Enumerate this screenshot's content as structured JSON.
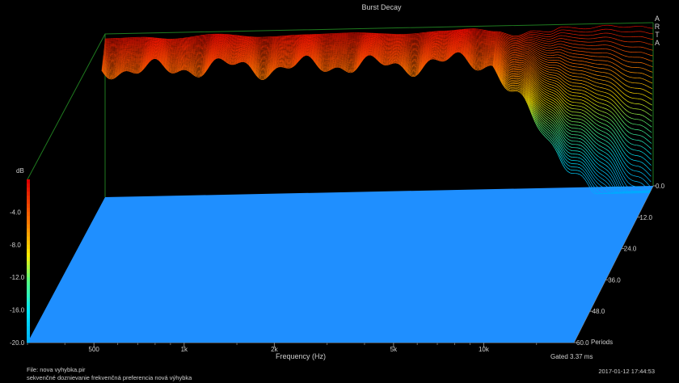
{
  "chart_data": {
    "type": "waterfall",
    "title": "Burst Decay",
    "brand": "ARTA",
    "xlabel": "Frequency (Hz)",
    "ylabel": "dB",
    "x_scale": "log",
    "xlim": [
      300,
      20000
    ],
    "x_ticks": [
      "500",
      "1k",
      "2k",
      "5k",
      "10k"
    ],
    "x_tick_values": [
      500,
      1000,
      2000,
      5000,
      10000
    ],
    "zlim": [
      -20,
      0
    ],
    "z_ticks": [
      "-4.0",
      "-8.0",
      "-12.0",
      "-16.0",
      "-20.0"
    ],
    "z_tick_values": [
      -4,
      -8,
      -12,
      -16,
      -20
    ],
    "depth_label": "Periods",
    "depth_ticks": [
      "0.0",
      "12.0",
      "24.0",
      "36.0",
      "48.0",
      "60.0"
    ],
    "depth_tick_values": [
      0,
      12,
      24,
      36,
      48,
      60
    ],
    "gated": "Gated 3.37 ms",
    "file": "File: nova vyhybka.pir",
    "description": "sekvenčné doznievanie frekvenčná preferencia nová výhybka",
    "datetime": "2017-01-12  17:44:53",
    "floor_color": "#1f8fff",
    "initial_response_db": {
      "freq_hz": [
        300,
        400,
        500,
        700,
        1000,
        1400,
        2000,
        3000,
        4000,
        5000,
        6000,
        7000,
        8000,
        9000,
        10000,
        12000,
        14000,
        16000,
        18000,
        20000
      ],
      "level_db": [
        -0.6,
        -0.5,
        -0.8,
        -0.3,
        -0.8,
        -0.6,
        -0.5,
        -0.8,
        -0.5,
        -0.3,
        -0.7,
        -1.3,
        -0.7,
        -0.9,
        -0.3,
        -0.6,
        -0.2,
        -0.5,
        -0.4,
        -0.7
      ]
    }
  }
}
